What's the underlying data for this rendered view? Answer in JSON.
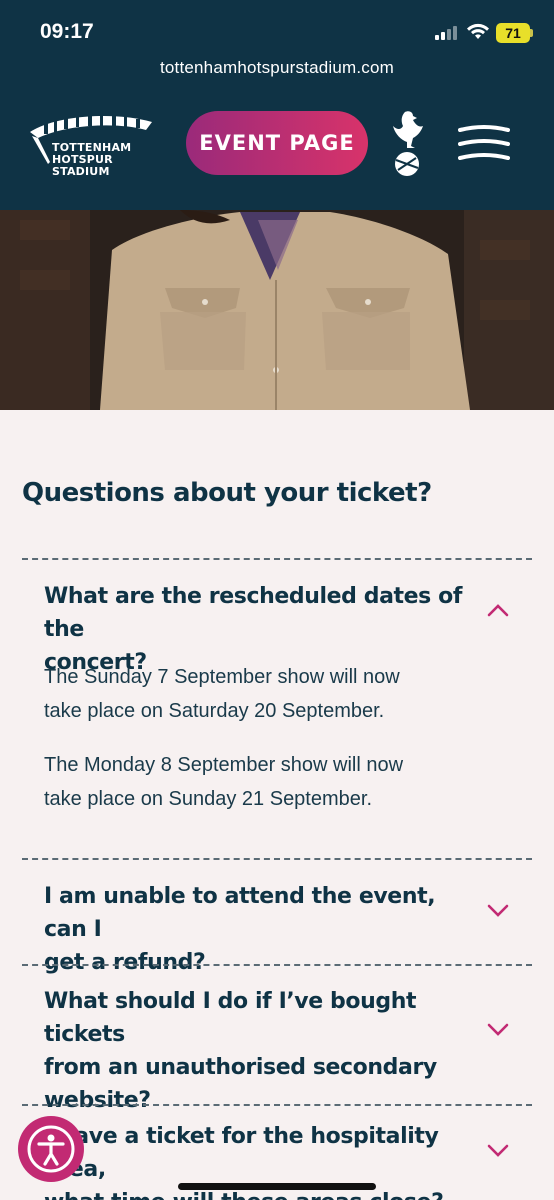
{
  "status": {
    "time": "09:17",
    "battery": "71"
  },
  "browser": {
    "url": "tottenhamhotspurstadium.com"
  },
  "nav": {
    "logo_line1": "TOTTENHAM",
    "logo_line2": "HOTSPUR",
    "logo_line3": "STADIUM",
    "event_button": "EVENT PAGE"
  },
  "faq": {
    "title": "Questions about your ticket?",
    "items": [
      {
        "question_line1": "What are the rescheduled dates of the",
        "question_line2": "concert?",
        "expanded": true,
        "answer_p1_line1": "The Sunday 7 September show will now",
        "answer_p1_line2": "take place on Saturday 20 September.",
        "answer_p2_line1": "The Monday 8 September show will now",
        "answer_p2_line2": "take place on Sunday 21 September."
      },
      {
        "question_line1": "I am unable to attend the event, can I",
        "question_line2": "get a refund?",
        "expanded": false
      },
      {
        "question_line1": "What should I do if I’ve bought tickets",
        "question_line2": "from an unauthorised secondary",
        "question_line3": "website?",
        "expanded": false
      },
      {
        "question_line1": "I have a ticket for the hospitality area,",
        "question_line2": "what time will these areas close?",
        "expanded": false
      }
    ]
  },
  "colors": {
    "navy": "#0f3345",
    "magenta": "#c22a73",
    "background": "#f7f1f1"
  },
  "icons": [
    "signal-icon",
    "wifi-icon",
    "battery-icon",
    "stadium-logo-icon",
    "cockerel-icon",
    "menu-icon",
    "chevron-up-icon",
    "chevron-down-icon",
    "accessibility-icon"
  ]
}
